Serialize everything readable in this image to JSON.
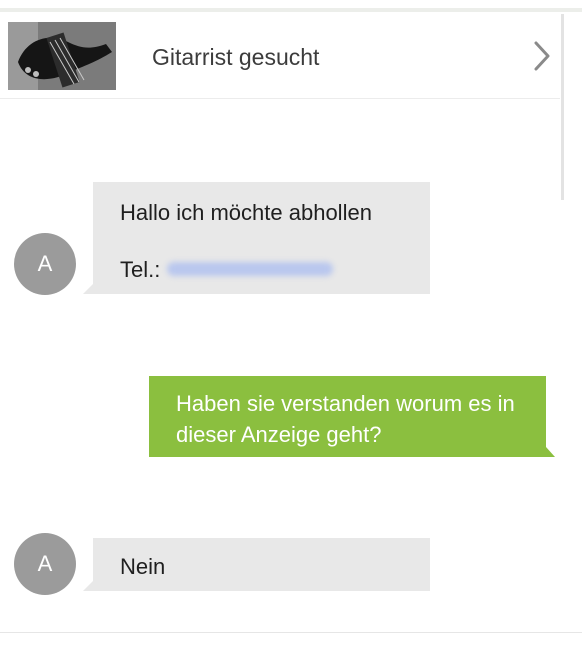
{
  "ad": {
    "title": "Gitarrist gesucht",
    "thumbnail_icon": "guitar-photo-icon",
    "chevron_icon": "chevron-right-icon"
  },
  "messages": [
    {
      "sender": "incoming",
      "avatar_letter": "A",
      "lines": [
        "Hallo ich möchte abhollen",
        "Tel.:"
      ],
      "redacted": true
    },
    {
      "sender": "outgoing",
      "text": "Haben sie verstanden worum es in dieser Anzeige geht?"
    },
    {
      "sender": "incoming",
      "avatar_letter": "A",
      "lines": [
        "Nein"
      ]
    }
  ],
  "colors": {
    "incoming_bubble": "#e8e8e8",
    "outgoing_bubble": "#8bbf3f",
    "avatar": "#9b9b9b",
    "redaction": "#b9c7ee"
  }
}
